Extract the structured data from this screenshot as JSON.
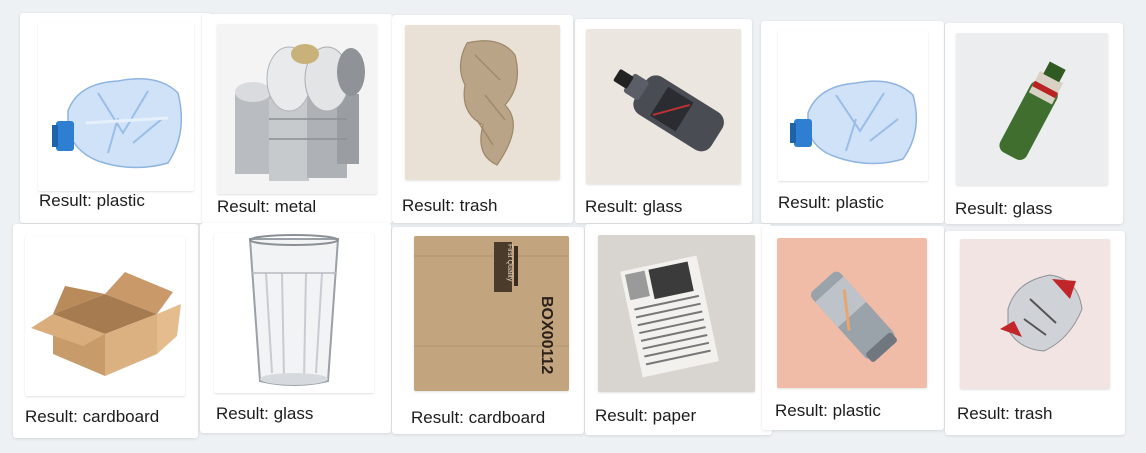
{
  "results": [
    {
      "label": "Result: plastic",
      "image": "crushed-plastic-bottle"
    },
    {
      "label": "Result: metal",
      "image": "metal-cans"
    },
    {
      "label": "Result: trash",
      "image": "crumpled-tissue"
    },
    {
      "label": "Result: glass",
      "image": "dark-glass-bottle"
    },
    {
      "label": "Result: plastic",
      "image": "crushed-plastic-bottle"
    },
    {
      "label": "Result: glass",
      "image": "green-glass-bottle"
    },
    {
      "label": "Result: cardboard",
      "image": "open-cardboard-box"
    },
    {
      "label": "Result: glass",
      "image": "drinking-glass"
    },
    {
      "label": "Result: cardboard",
      "image": "cardboard-panel"
    },
    {
      "label": "Result: paper",
      "image": "newspaper"
    },
    {
      "label": "Result: plastic",
      "image": "aluminum-can"
    },
    {
      "label": "Result: trash",
      "image": "snack-wrapper"
    }
  ],
  "image_texts": {
    "cardboard_panel_vertical": "BOX00112",
    "cardboard_panel_logo": "First Quality"
  },
  "colors": {
    "background": "#eef1f4",
    "card": "#ffffff"
  }
}
